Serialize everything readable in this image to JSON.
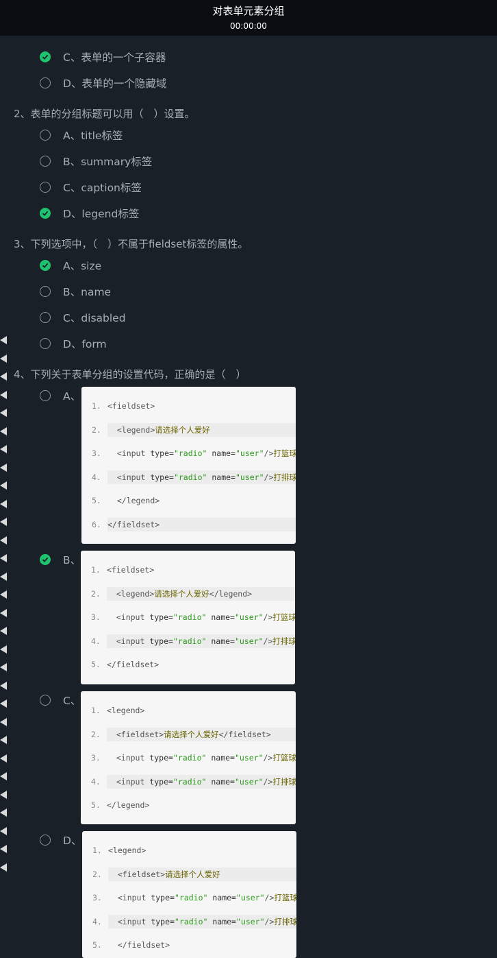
{
  "header": {
    "title": "对表单元素分组",
    "timer": "00:00:00"
  },
  "q1_tail": [
    {
      "label": "C、表单的一个子容器",
      "checked": true
    },
    {
      "label": "D、表单的一个隐藏域",
      "checked": false
    }
  ],
  "q2": {
    "text": "2、表单的分组标题可以用（　）设置。",
    "options": [
      {
        "label": "A、title标签",
        "checked": false
      },
      {
        "label": "B、summary标签",
        "checked": false
      },
      {
        "label": "C、caption标签",
        "checked": false
      },
      {
        "label": "D、legend标签",
        "checked": true
      }
    ]
  },
  "q3": {
    "text": "3、下列选项中，（　）不属于fieldset标签的属性。",
    "options": [
      {
        "label": "A、size",
        "checked": true
      },
      {
        "label": "B、name",
        "checked": false
      },
      {
        "label": "C、disabled",
        "checked": false
      },
      {
        "label": "D、form",
        "checked": false
      }
    ]
  },
  "q4": {
    "text": "4、下列关于表单分组的设置代码，正确的是（　）",
    "options": [
      {
        "label": "A、",
        "checked": false,
        "lines": [
          "<fieldset>",
          "  <legend>请选择个人爱好",
          "  <input type=\"radio\" name=\"user\"/>打篮球",
          "  <input type=\"radio\" name=\"user\"/>打排球",
          "  </legend>",
          "</fieldset>"
        ]
      },
      {
        "label": "B、",
        "checked": true,
        "lines": [
          "<fieldset>",
          "  <legend>请选择个人爱好</legend>",
          "  <input type=\"radio\" name=\"user\"/>打篮球",
          "  <input type=\"radio\" name=\"user\"/>打排球",
          "</fieldset>"
        ]
      },
      {
        "label": "C、",
        "checked": false,
        "lines": [
          "<legend>",
          "  <fieldset>请选择个人爱好</fieldset>",
          "  <input type=\"radio\" name=\"user\"/>打篮球",
          "  <input type=\"radio\" name=\"user\"/>打排球",
          "</legend>"
        ]
      },
      {
        "label": "D、",
        "checked": false,
        "lines": [
          "<legend>",
          "  <fieldset>请选择个人爱好",
          "  <input type=\"radio\" name=\"user\"/>打篮球",
          "  <input type=\"radio\" name=\"user\"/>打排球",
          "  </fieldset>"
        ]
      }
    ]
  },
  "colors": {
    "background": "#1a2028",
    "header": "#0a0e13",
    "check": "#1fc26f",
    "code_bg": "#f6f6f6"
  }
}
